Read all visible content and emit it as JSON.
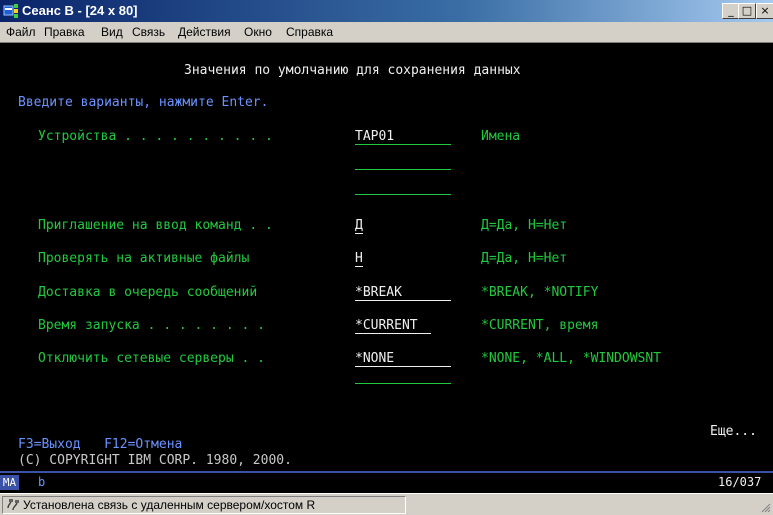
{
  "window": {
    "title": "Сеанс B - [24 x 80]",
    "minimize_label": "_",
    "maximize_label": "□",
    "close_label": "×"
  },
  "menu": [
    "Файл",
    "Правка",
    "Вид",
    "Связь",
    "Действия",
    "Окно",
    "Справка"
  ],
  "screen": {
    "heading": "Значения по умолчанию для сохранения данных",
    "instruction": "Введите варианты, нажмите Enter.",
    "fields": [
      {
        "label": "Устройства . . . . . . . . . .",
        "value": "TAP01",
        "hint": "Имена"
      },
      {
        "label": "Приглашение на ввод команд . .",
        "value": "Д",
        "hint": "Д=Да, Н=Нет"
      },
      {
        "label": "Проверять на активные файлы",
        "value": "Н",
        "hint": "Д=Да, Н=Нет"
      },
      {
        "label": "Доставка в очередь сообщений",
        "value": "*BREAK",
        "hint": "*BREAK, *NOTIFY"
      },
      {
        "label": "Время запуска . . . . . . . .",
        "value": "*CURRENT",
        "hint": "*CURRENT, время"
      },
      {
        "label": "Отключить сетевые серверы . .",
        "value": "*NONE",
        "hint": "*NONE, *ALL, *WINDOWSNT"
      }
    ],
    "more": "Еще...",
    "function_keys": "F3=Выход   F12=Отмена",
    "copyright": "(C) COPYRIGHT IBM CORP. 1980, 2000."
  },
  "oia": {
    "mode": "MA",
    "indicator": "b",
    "cursor_position": "16/037"
  },
  "status": {
    "message": "Установлена связь с удаленным сервером/хостом R"
  },
  "colors": {
    "terminal_bg": "#000000",
    "field_green": "#22c93f",
    "prompt_blue": "#6a93ff",
    "oia_blue": "#3a53a8"
  }
}
